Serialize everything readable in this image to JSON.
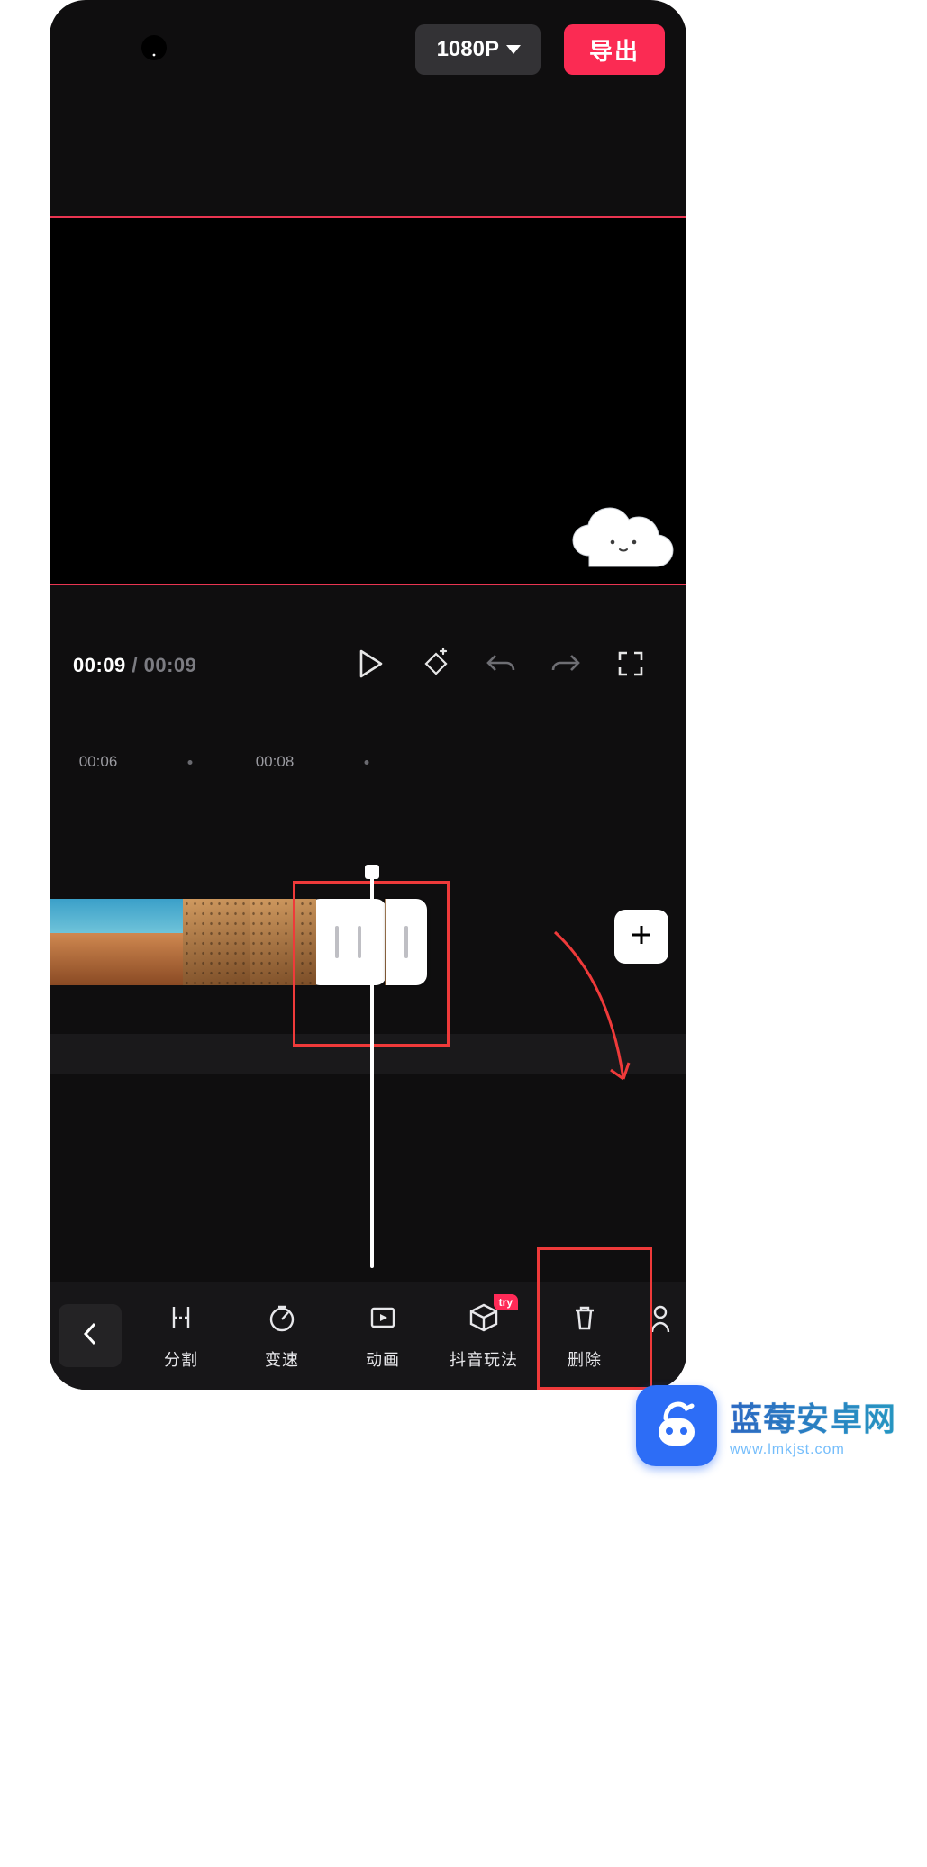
{
  "topbar": {
    "resolution": "1080P",
    "export_label": "导出"
  },
  "transport": {
    "current_time": "00:09",
    "separator": " / ",
    "duration": "00:09"
  },
  "ruler": {
    "ticks": [
      "00:06",
      "00:08"
    ]
  },
  "bottom_tools": {
    "items": [
      {
        "id": "split",
        "label": "分割"
      },
      {
        "id": "speed",
        "label": "变速"
      },
      {
        "id": "anim",
        "label": "动画"
      },
      {
        "id": "douyin",
        "label": "抖音玩法",
        "badge": "try"
      },
      {
        "id": "delete",
        "label": "删除"
      }
    ]
  },
  "watermark": {
    "title": "蓝莓安卓网",
    "sub": "www.lmkjst.com"
  }
}
